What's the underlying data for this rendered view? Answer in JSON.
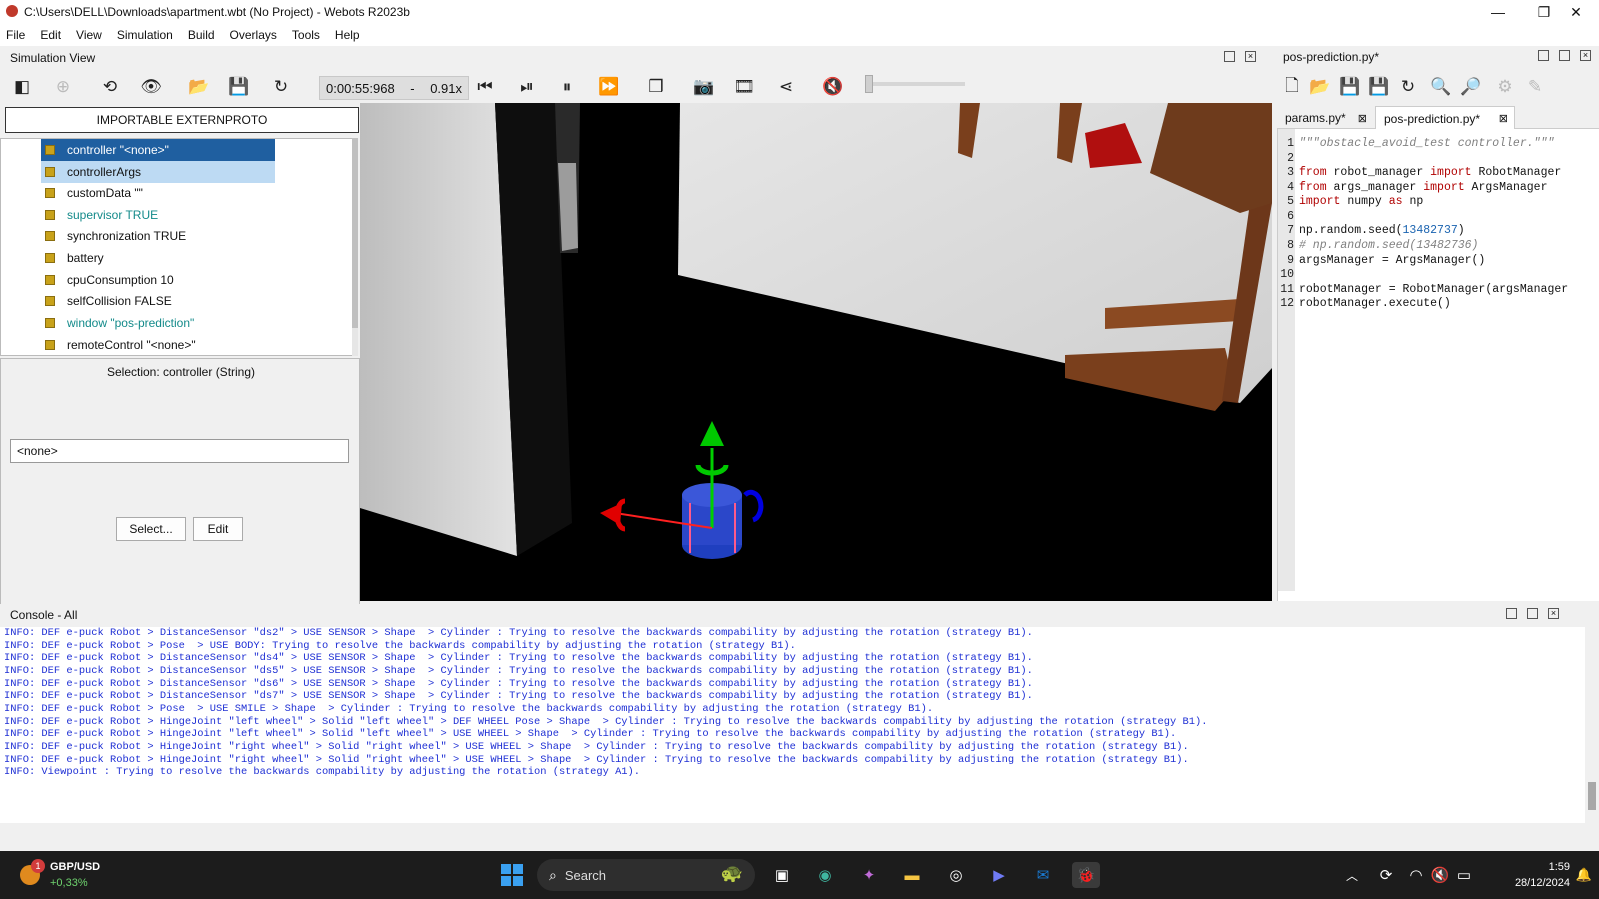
{
  "window": {
    "title": "C:\\Users\\DELL\\Downloads\\apartment.wbt (No Project) - Webots R2023b",
    "minimize": "—",
    "maximize": "❐",
    "close": "✕"
  },
  "menu": [
    "File",
    "Edit",
    "View",
    "Simulation",
    "Build",
    "Overlays",
    "Tools",
    "Help"
  ],
  "simulation_view": {
    "title": "Simulation View",
    "time": "0:00:55:968",
    "dash": "-",
    "speed": "0.91x"
  },
  "scene_tree": {
    "import_button": "IMPORTABLE EXTERNPROTO",
    "items": [
      {
        "label": "controller \"<none>\""
      },
      {
        "label": "controllerArgs"
      },
      {
        "label": "customData \"\""
      },
      {
        "label": "supervisor TRUE"
      },
      {
        "label": "synchronization TRUE"
      },
      {
        "label": "battery"
      },
      {
        "label": "cpuConsumption 10"
      },
      {
        "label": "selfCollision FALSE"
      },
      {
        "label": "window \"pos-prediction\""
      },
      {
        "label": "remoteControl \"<none>\""
      }
    ]
  },
  "field_editor": {
    "selection_label": "Selection: controller (String)",
    "value": "<none>",
    "select_button": "Select...",
    "edit_button": "Edit"
  },
  "editor": {
    "title": "pos-prediction.py*",
    "tabs": [
      {
        "label": "params.py*"
      },
      {
        "label": "pos-prediction.py*"
      }
    ],
    "tab_close": "⊠",
    "code_lines": [
      {
        "n": "1",
        "text": "\"\"\"obstacle_avoid_test controller.\"\"\""
      },
      {
        "n": "2",
        "text": ""
      },
      {
        "n": "3",
        "pre": "from",
        "mid": " robot_manager ",
        "kw2": "import",
        "post": " RobotManager"
      },
      {
        "n": "4",
        "pre": "from",
        "mid": " args_manager ",
        "kw2": "import",
        "post": " ArgsManager"
      },
      {
        "n": "5",
        "pre": "import",
        "mid": " numpy ",
        "kw2": "as",
        "post": " np"
      },
      {
        "n": "6",
        "text": ""
      },
      {
        "n": "7",
        "a": "np.random.seed(",
        "num": "13482737",
        "b": ")"
      },
      {
        "n": "8",
        "comment": "# np.random.seed(13482736)"
      },
      {
        "n": "9",
        "text": "argsManager = ArgsManager()"
      },
      {
        "n": "10",
        "text": ""
      },
      {
        "n": "11",
        "text": "robotManager = RobotManager(argsManager"
      },
      {
        "n": "12",
        "text": "robotManager.execute()"
      }
    ]
  },
  "console": {
    "title": "Console - All",
    "lines": [
      "INFO: DEF e-puck Robot > DistanceSensor \"ds2\" > USE SENSOR > Shape  > Cylinder : Trying to resolve the backwards compability by adjusting the rotation (strategy B1).",
      "INFO: DEF e-puck Robot > Pose  > USE BODY: Trying to resolve the backwards compability by adjusting the rotation (strategy B1).",
      "INFO: DEF e-puck Robot > DistanceSensor \"ds4\" > USE SENSOR > Shape  > Cylinder : Trying to resolve the backwards compability by adjusting the rotation (strategy B1).",
      "INFO: DEF e-puck Robot > DistanceSensor \"ds5\" > USE SENSOR > Shape  > Cylinder : Trying to resolve the backwards compability by adjusting the rotation (strategy B1).",
      "INFO: DEF e-puck Robot > DistanceSensor \"ds6\" > USE SENSOR > Shape  > Cylinder : Trying to resolve the backwards compability by adjusting the rotation (strategy B1).",
      "INFO: DEF e-puck Robot > DistanceSensor \"ds7\" > USE SENSOR > Shape  > Cylinder : Trying to resolve the backwards compability by adjusting the rotation (strategy B1).",
      "INFO: DEF e-puck Robot > Pose  > USE SMILE > Shape  > Cylinder : Trying to resolve the backwards compability by adjusting the rotation (strategy B1).",
      "INFO: DEF e-puck Robot > HingeJoint \"left wheel\" > Solid \"left wheel\" > DEF WHEEL Pose > Shape  > Cylinder : Trying to resolve the backwards compability by adjusting the rotation (strategy B1).",
      "INFO: DEF e-puck Robot > HingeJoint \"left wheel\" > Solid \"left wheel\" > USE WHEEL > Shape  > Cylinder : Trying to resolve the backwards compability by adjusting the rotation (strategy B1).",
      "INFO: DEF e-puck Robot > HingeJoint \"right wheel\" > Solid \"right wheel\" > USE WHEEL > Shape  > Cylinder : Trying to resolve the backwards compability by adjusting the rotation (strategy B1).",
      "INFO: DEF e-puck Robot > HingeJoint \"right wheel\" > Solid \"right wheel\" > USE WHEEL > Shape  > Cylinder : Trying to resolve the backwards compability by adjusting the rotation (strategy B1).",
      "INFO: Viewpoint : Trying to resolve the backwards compability by adjusting the rotation (strategy A1)."
    ]
  },
  "taskbar": {
    "widget_badge": "1",
    "widget_title": "GBP/USD",
    "widget_value": "+0,33%",
    "search_label": "Search",
    "time": "1:59",
    "date": "28/12/2024"
  },
  "colors": {
    "selection": "#1f5fa0",
    "selection_light": "#bddaf3",
    "console_text": "#1e2fd4",
    "keyword": "#b00000",
    "number": "#1a63b0",
    "wall": "#d9d9d9",
    "wood": "#8b4a22"
  }
}
